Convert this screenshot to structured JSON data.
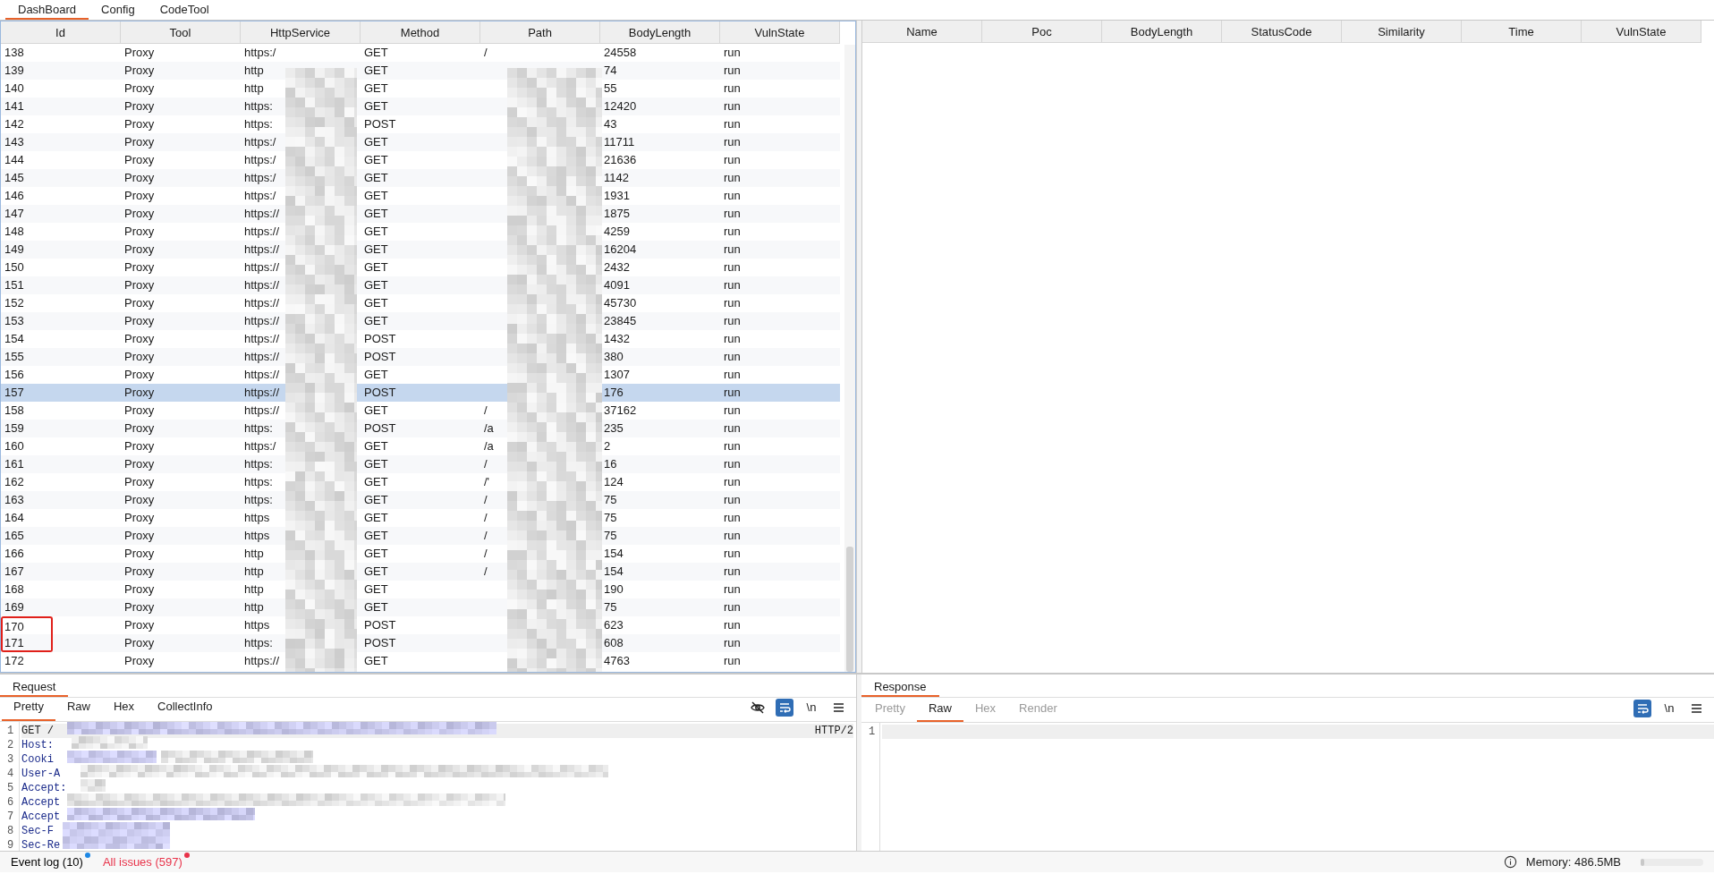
{
  "tabs": [
    {
      "label": "DashBoard",
      "selected": true
    },
    {
      "label": "Config",
      "selected": false
    },
    {
      "label": "CodeTool",
      "selected": false
    }
  ],
  "left_table": {
    "columns": [
      "Id",
      "Tool",
      "HttpService",
      "Method",
      "Path",
      "BodyLength",
      "VulnState"
    ],
    "rows": [
      {
        "id": "138",
        "tool": "Proxy",
        "service": "https:/",
        "method": "GET",
        "path": "/",
        "body_length": "24558",
        "vuln_state": "run",
        "selected": false,
        "highlighted": false
      },
      {
        "id": "139",
        "tool": "Proxy",
        "service": "http",
        "method": "GET",
        "body_length": "74",
        "vuln_state": "run",
        "selected": false,
        "highlighted": false
      },
      {
        "id": "140",
        "tool": "Proxy",
        "service": "http",
        "method": "GET",
        "body_length": "55",
        "vuln_state": "run",
        "selected": false,
        "highlighted": false
      },
      {
        "id": "141",
        "tool": "Proxy",
        "service": "https:",
        "method": "GET",
        "body_length": "12420",
        "vuln_state": "run",
        "selected": false,
        "highlighted": false
      },
      {
        "id": "142",
        "tool": "Proxy",
        "service": "https:",
        "method": "POST",
        "body_length": "43",
        "vuln_state": "run",
        "selected": false,
        "highlighted": false
      },
      {
        "id": "143",
        "tool": "Proxy",
        "service": "https:/",
        "method": "GET",
        "body_length": "11711",
        "vuln_state": "run",
        "selected": false,
        "highlighted": false
      },
      {
        "id": "144",
        "tool": "Proxy",
        "service": "https:/",
        "method": "GET",
        "body_length": "21636",
        "vuln_state": "run",
        "selected": false,
        "highlighted": false
      },
      {
        "id": "145",
        "tool": "Proxy",
        "service": "https:/",
        "method": "GET",
        "body_length": "1142",
        "vuln_state": "run",
        "selected": false,
        "highlighted": false
      },
      {
        "id": "146",
        "tool": "Proxy",
        "service": "https:/",
        "method": "GET",
        "body_length": "1931",
        "vuln_state": "run",
        "selected": false,
        "highlighted": false
      },
      {
        "id": "147",
        "tool": "Proxy",
        "service": "https://",
        "method": "GET",
        "body_length": "1875",
        "vuln_state": "run",
        "selected": false,
        "highlighted": false
      },
      {
        "id": "148",
        "tool": "Proxy",
        "service": "https://",
        "method": "GET",
        "body_length": "4259",
        "vuln_state": "run",
        "selected": false,
        "highlighted": false
      },
      {
        "id": "149",
        "tool": "Proxy",
        "service": "https://",
        "method": "GET",
        "body_length": "16204",
        "vuln_state": "run",
        "selected": false,
        "highlighted": false
      },
      {
        "id": "150",
        "tool": "Proxy",
        "service": "https://",
        "method": "GET",
        "body_length": "2432",
        "vuln_state": "run",
        "selected": false,
        "highlighted": false
      },
      {
        "id": "151",
        "tool": "Proxy",
        "service": "https://",
        "method": "GET",
        "body_length": "4091",
        "vuln_state": "run",
        "selected": false,
        "highlighted": false
      },
      {
        "id": "152",
        "tool": "Proxy",
        "service": "https://",
        "method": "GET",
        "body_length": "45730",
        "vuln_state": "run",
        "selected": false,
        "highlighted": false
      },
      {
        "id": "153",
        "tool": "Proxy",
        "service": "https://",
        "method": "GET",
        "body_length": "23845",
        "vuln_state": "run",
        "selected": false,
        "highlighted": false
      },
      {
        "id": "154",
        "tool": "Proxy",
        "service": "https://",
        "method": "POST",
        "body_length": "1432",
        "vuln_state": "run",
        "selected": false,
        "highlighted": false
      },
      {
        "id": "155",
        "tool": "Proxy",
        "service": "https://",
        "method": "POST",
        "body_length": "380",
        "vuln_state": "run",
        "selected": false,
        "highlighted": false
      },
      {
        "id": "156",
        "tool": "Proxy",
        "service": "https://",
        "method": "GET",
        "body_length": "1307",
        "vuln_state": "run",
        "selected": false,
        "highlighted": false
      },
      {
        "id": "157",
        "tool": "Proxy",
        "service": "https://",
        "method": "POST",
        "body_length": "176",
        "vuln_state": "run",
        "selected": true,
        "highlighted": false
      },
      {
        "id": "158",
        "tool": "Proxy",
        "service": "https://",
        "method": "GET",
        "path": "/",
        "body_length": "37162",
        "vuln_state": "run",
        "selected": false,
        "highlighted": false
      },
      {
        "id": "159",
        "tool": "Proxy",
        "service": "https:",
        "method": "POST",
        "path": "/a",
        "body_length": "235",
        "vuln_state": "run",
        "selected": false,
        "highlighted": false
      },
      {
        "id": "160",
        "tool": "Proxy",
        "service": "https:/",
        "method": "GET",
        "path": "/a",
        "body_length": "2",
        "vuln_state": "run",
        "selected": false,
        "highlighted": false
      },
      {
        "id": "161",
        "tool": "Proxy",
        "service": "https:",
        "method": "GET",
        "path": "/",
        "body_length": "16",
        "vuln_state": "run",
        "selected": false,
        "highlighted": false
      },
      {
        "id": "162",
        "tool": "Proxy",
        "service": "https:",
        "method": "GET",
        "path": "/'",
        "body_length": "124",
        "vuln_state": "run",
        "selected": false,
        "highlighted": false
      },
      {
        "id": "163",
        "tool": "Proxy",
        "service": "https:",
        "method": "GET",
        "path": "/",
        "body_length": "75",
        "vuln_state": "run",
        "selected": false,
        "highlighted": false
      },
      {
        "id": "164",
        "tool": "Proxy",
        "service": "https",
        "method": "GET",
        "path": "/",
        "body_length": "75",
        "vuln_state": "run",
        "selected": false,
        "highlighted": false
      },
      {
        "id": "165",
        "tool": "Proxy",
        "service": "https",
        "method": "GET",
        "path": "/",
        "body_length": "75",
        "vuln_state": "run",
        "selected": false,
        "highlighted": false
      },
      {
        "id": "166",
        "tool": "Proxy",
        "service": "http",
        "method": "GET",
        "path": "/",
        "body_length": "154",
        "vuln_state": "run",
        "selected": false,
        "highlighted": false
      },
      {
        "id": "167",
        "tool": "Proxy",
        "service": "http",
        "method": "GET",
        "path": "/",
        "body_length": "154",
        "vuln_state": "run",
        "selected": false,
        "highlighted": false
      },
      {
        "id": "168",
        "tool": "Proxy",
        "service": "http",
        "method": "GET",
        "body_length": "190",
        "vuln_state": "run",
        "selected": false,
        "highlighted": false
      },
      {
        "id": "169",
        "tool": "Proxy",
        "service": "http",
        "method": "GET",
        "body_length": "75",
        "vuln_state": "run",
        "selected": false,
        "highlighted": false
      },
      {
        "id": "170",
        "tool": "Proxy",
        "service": "https",
        "method": "POST",
        "body_length": "623",
        "vuln_state": "run",
        "selected": false,
        "highlighted": true
      },
      {
        "id": "171",
        "tool": "Proxy",
        "service": "https:",
        "method": "POST",
        "body_length": "608",
        "vuln_state": "run",
        "selected": false,
        "highlighted": true
      },
      {
        "id": "172",
        "tool": "Proxy",
        "service": "https://",
        "method": "GET",
        "body_length": "4763",
        "vuln_state": "run",
        "selected": false,
        "highlighted": false
      }
    ]
  },
  "right_table": {
    "columns": [
      "Name",
      "Poc",
      "BodyLength",
      "StatusCode",
      "Similarity",
      "Time",
      "VulnState"
    ]
  },
  "request": {
    "title": "Request",
    "tabs": [
      {
        "label": "Pretty",
        "selected": true,
        "disabled": false
      },
      {
        "label": "Raw",
        "selected": false,
        "disabled": false
      },
      {
        "label": "Hex",
        "selected": false,
        "disabled": false
      },
      {
        "label": "CollectInfo",
        "selected": false,
        "disabled": false
      }
    ],
    "toolbar": [
      {
        "kind": "hide",
        "on": false
      },
      {
        "kind": "wrap",
        "on": true
      },
      {
        "kind": "newline",
        "label": "\\n"
      },
      {
        "kind": "menu"
      }
    ],
    "lines": [
      {
        "number": "1",
        "kind": "request-line",
        "text": "GET /",
        "tail": "HTTP/2"
      },
      {
        "number": "2",
        "kind": "header",
        "text": "Host:"
      },
      {
        "number": "3",
        "kind": "header",
        "text": "Cooki"
      },
      {
        "number": "4",
        "kind": "header",
        "text": "User-A"
      },
      {
        "number": "5",
        "kind": "header",
        "text": "Accept:"
      },
      {
        "number": "6",
        "kind": "header",
        "text": "Accept"
      },
      {
        "number": "7",
        "kind": "header",
        "text": "Accept"
      },
      {
        "number": "8",
        "kind": "header",
        "text": "Sec-F"
      },
      {
        "number": "9",
        "kind": "header",
        "text": "Sec-Re"
      }
    ]
  },
  "response": {
    "title": "Response",
    "tabs": [
      {
        "label": "Pretty",
        "selected": false,
        "disabled": true
      },
      {
        "label": "Raw",
        "selected": true,
        "disabled": false
      },
      {
        "label": "Hex",
        "selected": false,
        "disabled": true
      },
      {
        "label": "Render",
        "selected": false,
        "disabled": true
      }
    ],
    "toolbar": [
      {
        "kind": "wrap",
        "on": true
      },
      {
        "kind": "newline",
        "label": "\\n"
      },
      {
        "kind": "menu"
      }
    ],
    "lines": [
      {
        "number": "1"
      }
    ]
  },
  "status_bar": {
    "items": [
      {
        "label": "Event log (10)",
        "kind": "log",
        "color": "#1e88e5"
      },
      {
        "label": "All issues (597)",
        "kind": "issues",
        "color": "#e8334a"
      }
    ],
    "memory": "Memory: 486.5MB",
    "memory_meter": {
      "level": 0.06
    }
  }
}
